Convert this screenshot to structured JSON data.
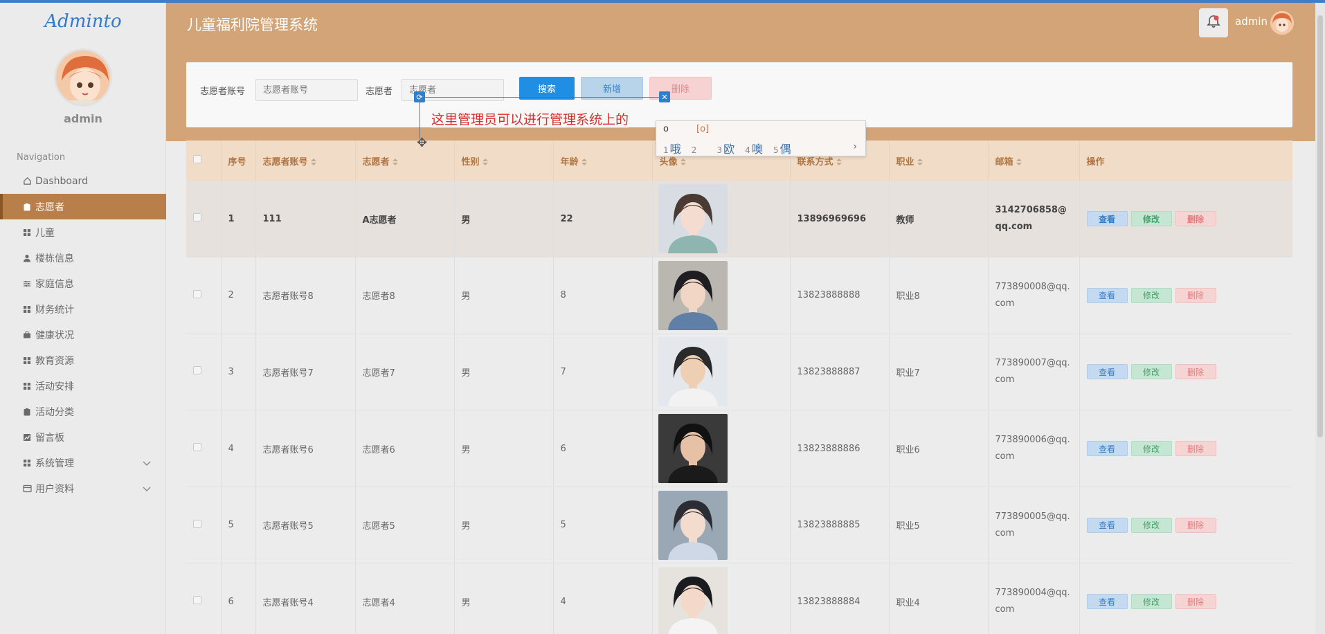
{
  "sidebar": {
    "logo": "Adminto",
    "username": "admin",
    "nav_title": "Navigation",
    "items": [
      {
        "label": "Dashboard",
        "icon": "home-icon"
      },
      {
        "label": "志愿者",
        "icon": "clipboard-icon",
        "active": true
      },
      {
        "label": "儿童",
        "icon": "grid-icon"
      },
      {
        "label": "楼栋信息",
        "icon": "user-icon"
      },
      {
        "label": "家庭信息",
        "icon": "sliders-icon"
      },
      {
        "label": "财务统计",
        "icon": "grid-icon"
      },
      {
        "label": "健康状况",
        "icon": "briefcase-icon"
      },
      {
        "label": "教育资源",
        "icon": "grid-icon"
      },
      {
        "label": "活动安排",
        "icon": "grid-icon"
      },
      {
        "label": "活动分类",
        "icon": "clipboard-icon"
      },
      {
        "label": "留言板",
        "icon": "chart-icon"
      },
      {
        "label": "系统管理",
        "icon": "grid-icon",
        "has_submenu": true
      },
      {
        "label": "用户资料",
        "icon": "card-icon",
        "has_submenu": true
      }
    ]
  },
  "header": {
    "title": "儿童福利院管理系统",
    "username": "admin"
  },
  "search": {
    "account_label": "志愿者账号",
    "account_placeholder": "志愿者账号",
    "name_label": "志愿者",
    "name_placeholder": "志愿者",
    "search_button": "搜索",
    "add_button": "新增",
    "delete_button": "删除"
  },
  "annotation": {
    "text": "这里管理员可以进行管理系统上的"
  },
  "ime": {
    "input": "o",
    "code": "[o]",
    "candidates": [
      {
        "num": "1",
        "text": "哦"
      },
      {
        "num": "2",
        "text": ""
      },
      {
        "num": "3",
        "text": "欧"
      },
      {
        "num": "4",
        "text": "噢"
      },
      {
        "num": "5",
        "text": "偶"
      }
    ]
  },
  "table": {
    "headers": [
      "序号",
      "志愿者账号",
      "志愿者",
      "性别",
      "年龄",
      "头像",
      "联系方式",
      "职业",
      "邮箱",
      "操作"
    ],
    "action_labels": {
      "view": "查看",
      "edit": "修改",
      "delete": "删除"
    },
    "rows": [
      {
        "no": "1",
        "account": "111",
        "name": "A志愿者",
        "gender": "男",
        "age": "22",
        "phone": "13896969696",
        "job": "教师",
        "email": "3142706858@qq.com"
      },
      {
        "no": "2",
        "account": "志愿者账号8",
        "name": "志愿者8",
        "gender": "男",
        "age": "8",
        "phone": "13823888888",
        "job": "职业8",
        "email": "773890008@qq.com"
      },
      {
        "no": "3",
        "account": "志愿者账号7",
        "name": "志愿者7",
        "gender": "男",
        "age": "7",
        "phone": "13823888887",
        "job": "职业7",
        "email": "773890007@qq.com"
      },
      {
        "no": "4",
        "account": "志愿者账号6",
        "name": "志愿者6",
        "gender": "男",
        "age": "6",
        "phone": "13823888886",
        "job": "职业6",
        "email": "773890006@qq.com"
      },
      {
        "no": "5",
        "account": "志愿者账号5",
        "name": "志愿者5",
        "gender": "男",
        "age": "5",
        "phone": "13823888885",
        "job": "职业5",
        "email": "773890005@qq.com"
      },
      {
        "no": "6",
        "account": "志愿者账号4",
        "name": "志愿者4",
        "gender": "男",
        "age": "4",
        "phone": "13823888884",
        "job": "职业4",
        "email": "773890004@qq.com"
      }
    ]
  },
  "colors": {
    "header_bg": "#d2a477",
    "sidebar_active": "#b97f4a",
    "primary_blue": "#1f8ee3",
    "table_header_bg": "#f1dcc8"
  }
}
